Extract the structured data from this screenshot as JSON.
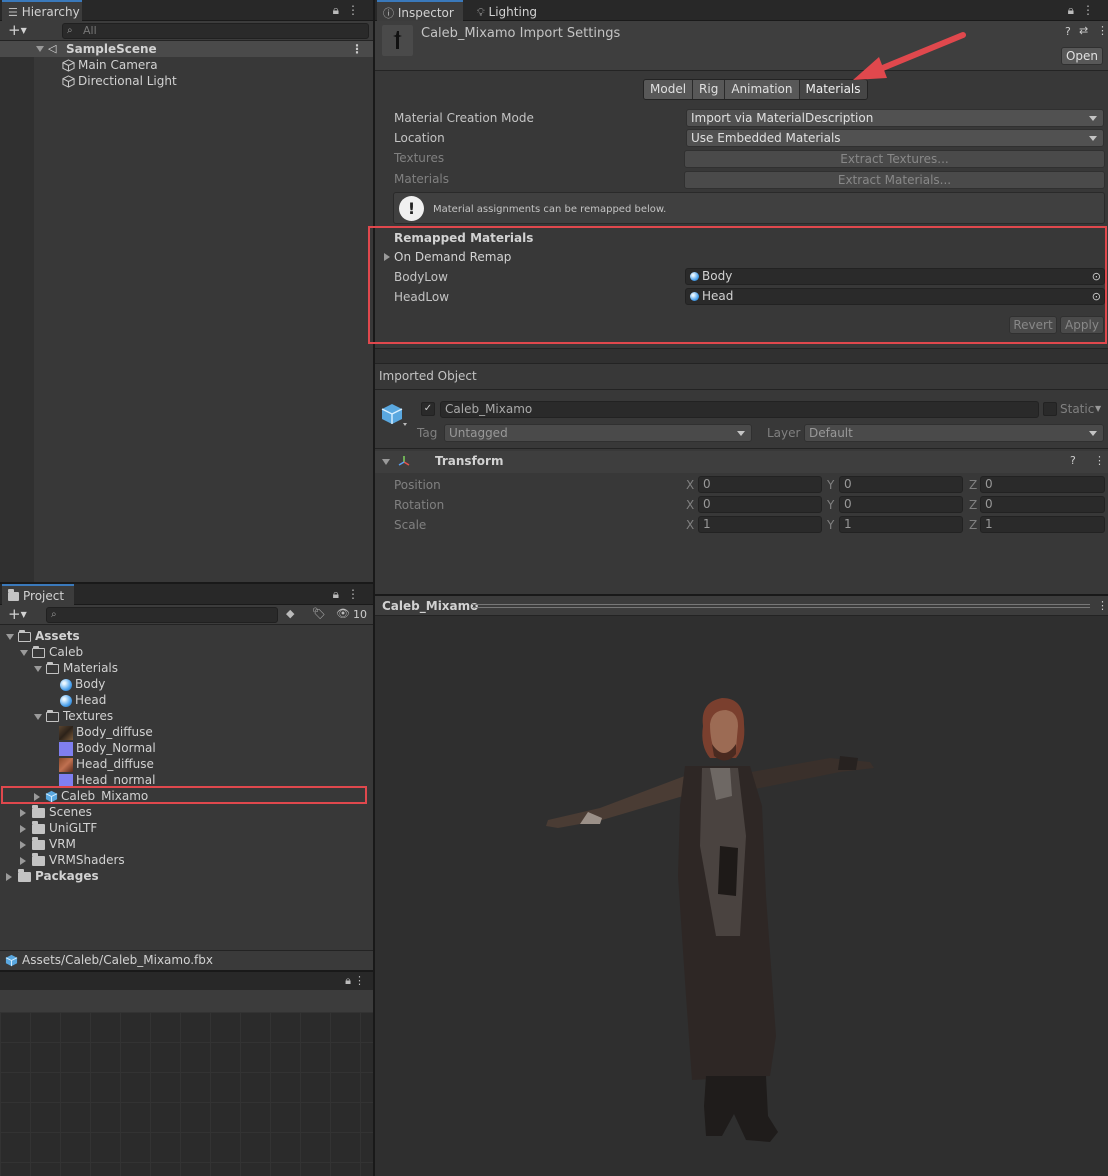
{
  "hierarchy": {
    "tab_label": "Hierarchy",
    "search_placeholder": "All",
    "scene_name": "SampleScene",
    "items": [
      "Main Camera",
      "Directional Light"
    ]
  },
  "project": {
    "tab_label": "Project",
    "hidden_count": "10",
    "tree": {
      "assets": "Assets",
      "caleb": "Caleb",
      "materials": "Materials",
      "body": "Body",
      "head": "Head",
      "textures": "Textures",
      "body_diffuse": "Body_diffuse",
      "body_normal": "Body_Normal",
      "head_diffuse": "Head_diffuse",
      "head_normal": "Head_normal",
      "caleb_mixamo": "Caleb_Mixamo",
      "scenes": "Scenes",
      "unigltf": "UniGLTF",
      "vrm": "VRM",
      "vrmshaders": "VRMShaders",
      "packages": "Packages"
    },
    "path": "Assets/Caleb/Caleb_Mixamo.fbx"
  },
  "inspector": {
    "tab_label": "Inspector",
    "lighting_tab_label": "Lighting",
    "title": "Caleb_Mixamo Import Settings",
    "open_label": "Open",
    "tabs": [
      "Model",
      "Rig",
      "Animation",
      "Materials"
    ],
    "active_tab": "Materials",
    "material_creation_mode_label": "Material Creation Mode",
    "material_creation_mode_value": "Import via MaterialDescription",
    "location_label": "Location",
    "location_value": "Use Embedded Materials",
    "textures_label": "Textures",
    "extract_textures_label": "Extract Textures...",
    "materials_label": "Materials",
    "extract_materials_label": "Extract Materials...",
    "info_message": "Material assignments can be remapped below.",
    "remapped_header": "Remapped Materials",
    "on_demand_remap": "On Demand Remap",
    "remaps": [
      {
        "name": "BodyLow",
        "value": "Body"
      },
      {
        "name": "HeadLow",
        "value": "Head"
      }
    ],
    "revert_label": "Revert",
    "apply_label": "Apply",
    "imported_object_label": "Imported Object",
    "object_name": "Caleb_Mixamo",
    "static_label": "Static",
    "tag_label": "Tag",
    "tag_value": "Untagged",
    "layer_label": "Layer",
    "layer_value": "Default",
    "transform_label": "Transform",
    "position_label": "Position",
    "rotation_label": "Rotation",
    "scale_label": "Scale",
    "axis_x": "X",
    "axis_y": "Y",
    "axis_z": "Z",
    "position": [
      "0",
      "0",
      "0"
    ],
    "rotation": [
      "0",
      "0",
      "0"
    ],
    "scale": [
      "1",
      "1",
      "1"
    ]
  },
  "preview": {
    "title": "Caleb_Mixamo"
  },
  "colors": {
    "accent_tab": "#3a79bb",
    "highlight_red": "#e0484d",
    "panel_bg": "#383838",
    "preview_bg": "#2f2f2f"
  }
}
